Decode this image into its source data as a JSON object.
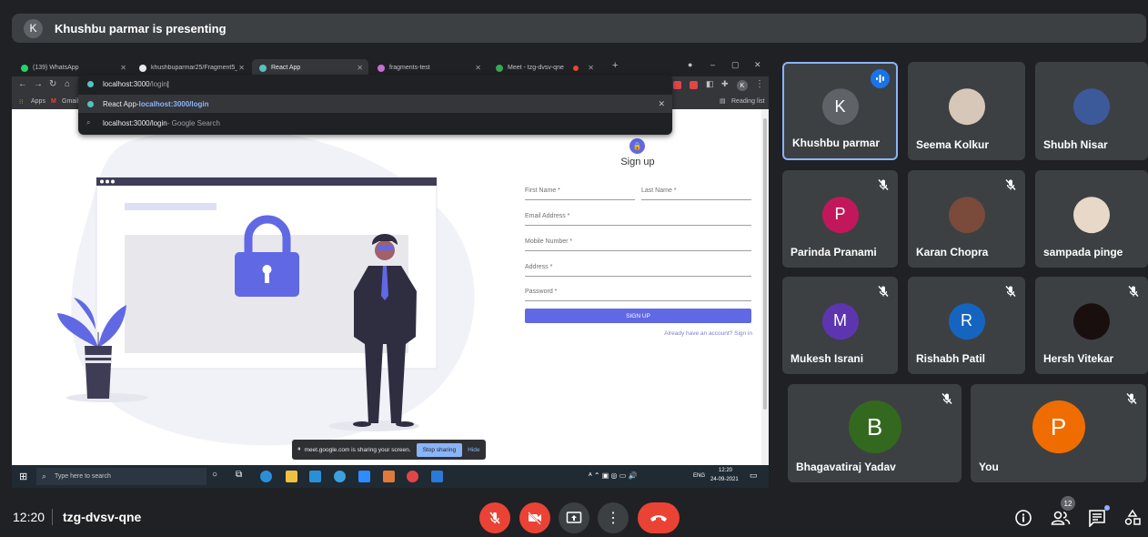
{
  "top_bar": {
    "avatar_letter": "K",
    "presenter_text": "Khushbu parmar is presenting"
  },
  "browser": {
    "tabs": [
      {
        "label": "(139) WhatsApp",
        "icon": "whatsapp-icon",
        "color": "#25d366"
      },
      {
        "label": "khushbuparmar25/Fragment5_C",
        "icon": "github-icon",
        "color": "#e8eaed"
      },
      {
        "label": "React App",
        "icon": "react-icon",
        "color": "#56c2c2"
      },
      {
        "label": "fragments-test",
        "icon": "firebase-icon",
        "color": "#c86dd7"
      },
      {
        "label": "Meet - tzg-dvsv-qne",
        "icon": "meet-icon",
        "color": "#34a853"
      }
    ],
    "new_tab_label": "+",
    "address": {
      "typed": "localhost:3000",
      "dim": "/login",
      "cursor": "|"
    },
    "suggestions": [
      {
        "title": "React App",
        "sep": " - ",
        "url": "localhost:3000/login"
      },
      {
        "text": "localhost:3000/login",
        "suffix": " - Google Search"
      }
    ],
    "bookmarks": {
      "apps": "Apps",
      "gmail": "Gmail",
      "reading_list": "Reading list"
    },
    "profile_letter": "K"
  },
  "signup_form": {
    "title": "Sign up",
    "first_name": "First Name *",
    "last_name": "Last Name *",
    "email": "Email Address *",
    "mobile": "Mobile Number *",
    "address": "Address *",
    "password": "Password *",
    "button": "SIGN UP",
    "signin_link": "Already have an account? Sign in"
  },
  "share_bar": {
    "message": "meet.google.com is sharing your screen.",
    "stop": "Stop sharing",
    "hide": "Hide"
  },
  "taskbar": {
    "search_placeholder": "Type here to search",
    "lang": "ENG",
    "time": "12:20",
    "date": "24-09-2021"
  },
  "participants": [
    {
      "name": "Khushbu parmar",
      "letter": "K",
      "color": "#5f6368",
      "speaking": true,
      "muted": false
    },
    {
      "name": "Seema Kolkur",
      "letter": "",
      "color": "#d7c7b8",
      "speaking": false,
      "muted": false
    },
    {
      "name": "Shubh Nisar",
      "letter": "",
      "color": "#3c5a9a",
      "speaking": false,
      "muted": false
    },
    {
      "name": "Parinda Pranami",
      "letter": "P",
      "color": "#c2185b",
      "speaking": false,
      "muted": true
    },
    {
      "name": "Karan Chopra",
      "letter": "",
      "color": "#7a4a3a",
      "speaking": false,
      "muted": true
    },
    {
      "name": "sampada pinge",
      "letter": "",
      "color": "#e8d8c8",
      "speaking": false,
      "muted": false
    },
    {
      "name": "Mukesh Israni",
      "letter": "M",
      "color": "#5e35b1",
      "speaking": false,
      "muted": true
    },
    {
      "name": "Rishabh Patil",
      "letter": "R",
      "color": "#1565c0",
      "speaking": false,
      "muted": true
    },
    {
      "name": "Hersh Vitekar",
      "letter": "",
      "color": "#1a0f0f",
      "speaking": false,
      "muted": true
    },
    {
      "name": "Bhagavatiraj Yadav",
      "letter": "B",
      "color": "#33691e",
      "speaking": false,
      "muted": true
    },
    {
      "name": "You",
      "letter": "P",
      "color": "#ef6c00",
      "speaking": false,
      "muted": true
    }
  ],
  "bottom_bar": {
    "time": "12:20",
    "meeting_code": "tzg-dvsv-qne",
    "people_count": "12"
  }
}
